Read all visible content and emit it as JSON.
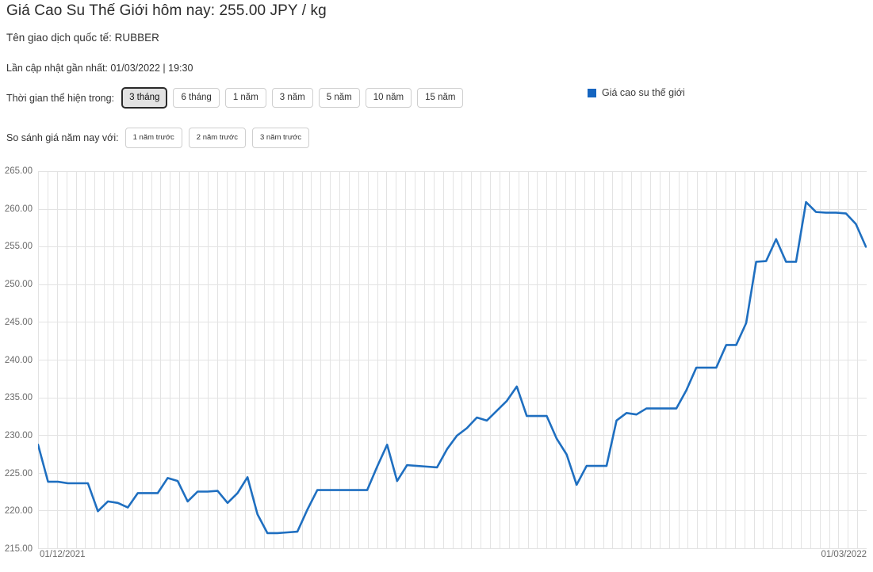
{
  "header": {
    "title": "Giá Cao Su Thế Giới hôm nay: 255.00 JPY / kg",
    "subtitle": "Tên giao dịch quốc tế: RUBBER",
    "updated": "Lần cập nhật gần nhất: 01/03/2022 | 19:30"
  },
  "controls": {
    "period_label": "Thời gian thể hiện trong:",
    "period_buttons": [
      {
        "label": "3 tháng",
        "active": true
      },
      {
        "label": "6 tháng",
        "active": false
      },
      {
        "label": "1 năm",
        "active": false
      },
      {
        "label": "3 năm",
        "active": false
      },
      {
        "label": "5 năm",
        "active": false
      },
      {
        "label": "10 năm",
        "active": false
      },
      {
        "label": "15 năm",
        "active": false
      }
    ],
    "compare_label": "So sánh giá năm nay với:",
    "compare_buttons": [
      {
        "label": "1 năm trước",
        "active": false
      },
      {
        "label": "2 năm trước",
        "active": false
      },
      {
        "label": "3 năm trước",
        "active": false
      }
    ]
  },
  "legend": {
    "items": [
      {
        "label": "Giá cao su thế giới",
        "color": "#1565C0",
        "icon": "square-swatch-icon"
      }
    ]
  },
  "colors": {
    "line": "#1f6fc0",
    "grid": "#e3e3e3",
    "axis_text": "#6b6b6b"
  },
  "chart_data": {
    "type": "line",
    "title": "Giá Cao Su Thế Giới hôm nay: 255.00 JPY / kg",
    "xlabel": "",
    "ylabel": "JPY / kg",
    "ylim": [
      215.0,
      265.0
    ],
    "ytick_step": 5.0,
    "yticks": [
      "265.00",
      "260.00",
      "255.00",
      "250.00",
      "245.00",
      "240.00",
      "235.00",
      "230.00",
      "225.00",
      "220.00",
      "215.00"
    ],
    "xticks": [
      "01/12/2021",
      "01/03/2022"
    ],
    "x_start": "01/12/2021",
    "x_end": "01/03/2022",
    "grid": true,
    "legend_position": "top-right",
    "series": [
      {
        "name": "Giá cao su thế giới",
        "color": "#1f6fc0",
        "values": [
          228.8,
          223.9,
          223.9,
          223.7,
          223.7,
          223.7,
          220.0,
          221.3,
          221.1,
          220.5,
          222.4,
          222.4,
          222.4,
          224.4,
          224.0,
          221.3,
          222.6,
          222.6,
          222.7,
          221.1,
          222.4,
          224.5,
          219.6,
          217.1,
          217.1,
          217.2,
          217.3,
          220.2,
          222.8,
          222.8,
          222.8,
          222.8,
          222.8,
          222.8,
          225.9,
          228.8,
          224.0,
          226.1,
          226.0,
          225.9,
          225.8,
          228.2,
          230.0,
          231.0,
          232.4,
          232.0,
          233.3,
          234.6,
          236.5,
          232.6,
          232.6,
          232.6,
          229.6,
          227.5,
          223.5,
          226.0,
          226.0,
          226.0,
          232.0,
          233.0,
          232.8,
          233.6,
          233.6,
          233.6,
          233.6,
          236.0,
          239.0,
          239.0,
          239.0,
          242.0,
          242.0,
          244.9,
          253.0,
          253.1,
          256.0,
          253.0,
          253.0,
          260.9,
          259.6,
          259.5,
          259.5,
          259.4,
          258.0,
          255.0
        ]
      }
    ]
  }
}
